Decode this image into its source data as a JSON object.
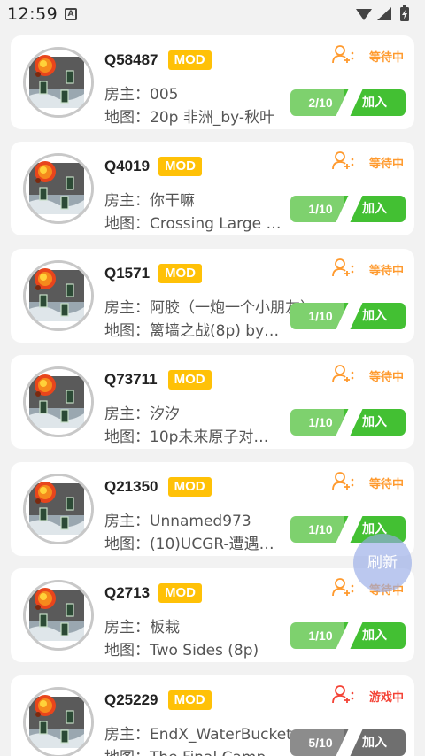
{
  "status_bar": {
    "time": "12:59",
    "notif_letter": "A"
  },
  "common": {
    "host_prefix": "房主：",
    "map_prefix": "地图：",
    "mod": "MOD",
    "join": "加入"
  },
  "rooms": [
    {
      "id": "Q58487",
      "host": "005",
      "map": "20p 非洲_by-秋叶",
      "status": "等待中",
      "count": "2/10"
    },
    {
      "id": "Q4019",
      "host": "你干嘛",
      "map": "Crossing Large …",
      "status": "等待中",
      "count": "1/10"
    },
    {
      "id": "Q1571",
      "host": "阿胶（一炮一个小朋友）",
      "map": "篱墙之战(8p) by…",
      "status": "等待中",
      "count": "1/10"
    },
    {
      "id": "Q73711",
      "host": "汐汐",
      "map": "10p未来原子对…",
      "status": "等待中",
      "count": "1/10"
    },
    {
      "id": "Q21350",
      "host": "Unnamed973",
      "map": "(10)UCGR-遭遇…",
      "status": "等待中",
      "count": "1/10"
    },
    {
      "id": "Q2713",
      "host": "板栽",
      "map": "Two Sides (8p)",
      "status": "等待中",
      "count": "1/10"
    },
    {
      "id": "Q25229",
      "host": "EndX_WaterBucket",
      "map": "The Final Camp…",
      "status": "游戏中",
      "count": "5/10"
    }
  ],
  "refresh_label": "刷新",
  "colors": {
    "waiting": "#ff9a2e",
    "playing": "#f44336",
    "join_green": "#43c033",
    "mod_badge": "#ffc107"
  }
}
